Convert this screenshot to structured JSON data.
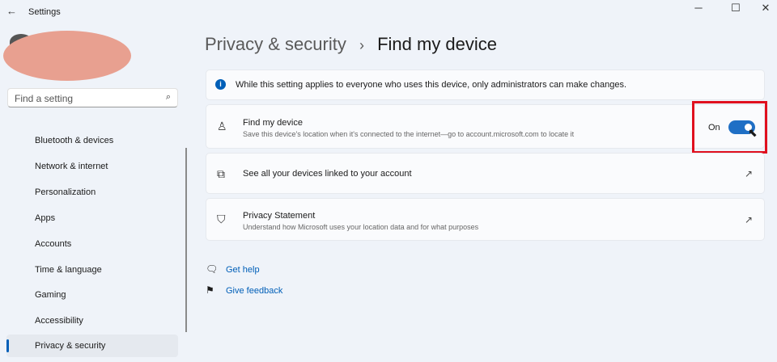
{
  "window": {
    "title": "Settings",
    "back_icon": "arrow-left",
    "controls": [
      "minimize",
      "maximize",
      "close"
    ]
  },
  "search": {
    "placeholder": "Find a setting"
  },
  "sidebar": {
    "items": [
      {
        "label": "Bluetooth & devices"
      },
      {
        "label": "Network & internet"
      },
      {
        "label": "Personalization"
      },
      {
        "label": "Apps"
      },
      {
        "label": "Accounts"
      },
      {
        "label": "Time & language"
      },
      {
        "label": "Gaming"
      },
      {
        "label": "Accessibility"
      },
      {
        "label": "Privacy & security",
        "selected": true
      }
    ]
  },
  "breadcrumb": {
    "parent": "Privacy & security",
    "separator": "›",
    "current": "Find my device"
  },
  "info": {
    "text": "While this setting applies to everyone who uses this device, only administrators can make changes."
  },
  "find_device": {
    "title": "Find my device",
    "description": "Save this device's location when it's connected to the internet—go to account.microsoft.com to locate it",
    "state_label": "On",
    "enabled": true
  },
  "devices": {
    "title": "See all your devices linked to your account"
  },
  "privacy": {
    "title": "Privacy Statement",
    "description": "Understand how Microsoft uses your location data and for what purposes"
  },
  "links": {
    "help": "Get help",
    "feedback": "Give feedback"
  },
  "colors": {
    "accent": "#005fb8",
    "highlight": "#e0101e"
  }
}
